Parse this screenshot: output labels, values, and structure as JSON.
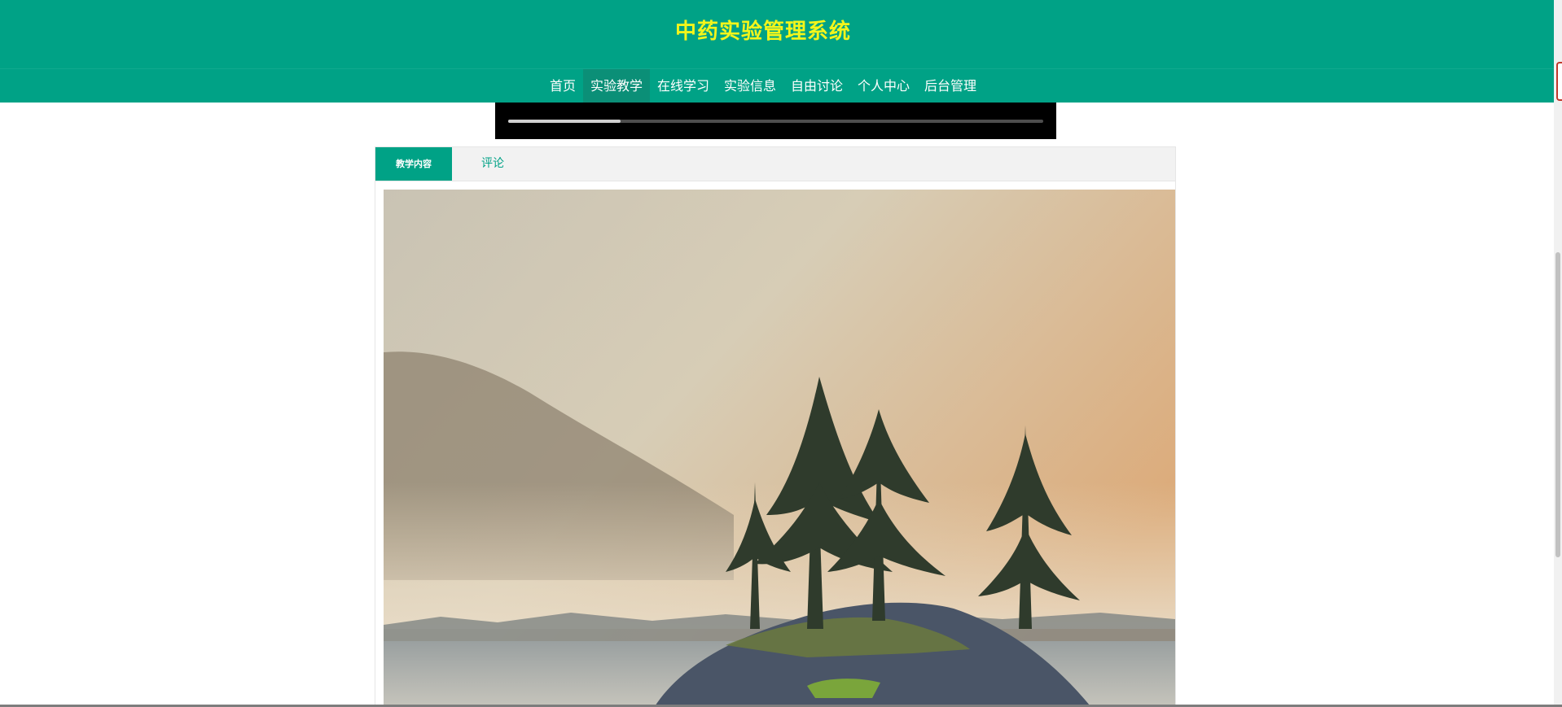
{
  "header": {
    "site_title": "中药实验管理系统",
    "nav": [
      {
        "label": "首页",
        "active": false
      },
      {
        "label": "实验教学",
        "active": true
      },
      {
        "label": "在线学习",
        "active": false
      },
      {
        "label": "实验信息",
        "active": false
      },
      {
        "label": "自由讨论",
        "active": false
      },
      {
        "label": "个人中心",
        "active": false
      },
      {
        "label": "后台管理",
        "active": false
      }
    ]
  },
  "video": {
    "progress_fraction": 0.21
  },
  "tabs": [
    {
      "label": "教学内容",
      "active": true
    },
    {
      "label": "评论",
      "active": false
    }
  ],
  "colors": {
    "primary": "#00a286",
    "title": "#f3f51b",
    "nav_active": "#0b8f77"
  },
  "content": {
    "image_icon": "landscape-photo-misty-island-trees"
  }
}
